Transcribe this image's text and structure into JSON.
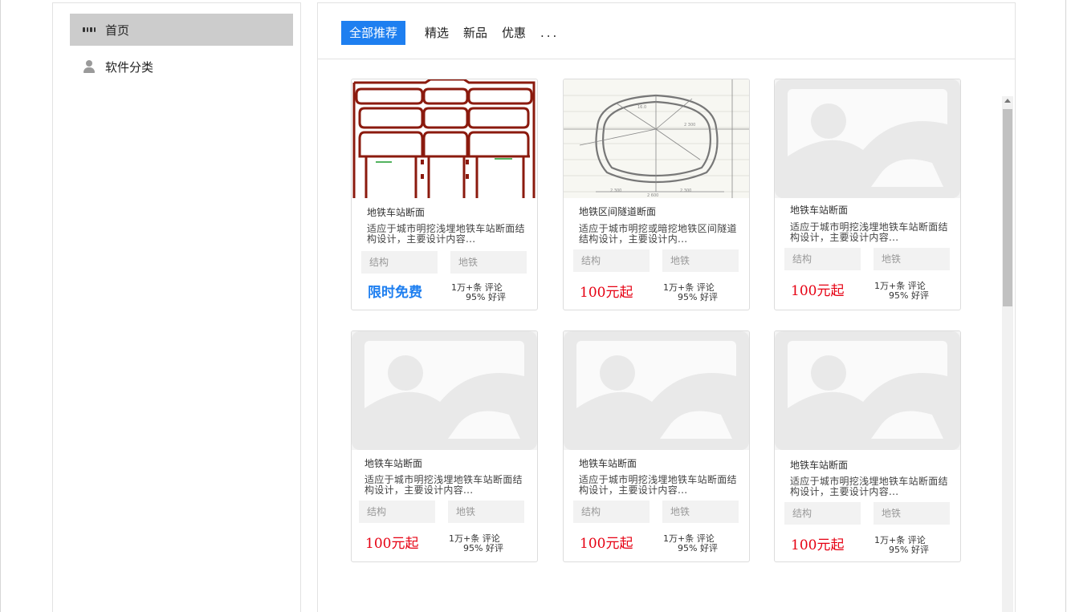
{
  "sidebar": {
    "items": [
      {
        "label": "首页",
        "icon": "grid-icon",
        "active": true
      },
      {
        "label": "软件分类",
        "icon": "user-icon",
        "active": false
      }
    ]
  },
  "tabs": [
    {
      "label": "全部推荐",
      "active": true
    },
    {
      "label": "精选"
    },
    {
      "label": "新品"
    },
    {
      "label": "优惠"
    },
    {
      "label": "..."
    }
  ],
  "cards": [
    {
      "title": "地铁车站断面",
      "desc": "适应于城市明挖浅埋地铁车站断面结构设计，主要设计内容...",
      "tags": [
        "结构",
        "地铁"
      ],
      "price": "限时免费",
      "stat_line1": "1万+条 评论",
      "stat_line2": "95% 好评",
      "image": "station-section-drawing"
    },
    {
      "title": "地铁区间隧道断面",
      "desc": "适应于城市明挖或暗挖地铁区间隧道结构设计，主要设计内...",
      "tags": [
        "结构",
        "地铁"
      ],
      "price": "100元起",
      "stat_line1": "1万+条 评论",
      "stat_line2": "95% 好评",
      "image": "tunnel-section-drawing"
    },
    {
      "title": "地铁车站断面",
      "desc": "适应于城市明挖浅埋地铁车站断面结构设计，主要设计内容...",
      "tags": [
        "结构",
        "地铁"
      ],
      "price": "100元起",
      "stat_line1": "1万+条 评论",
      "stat_line2": "95% 好评",
      "image": "image-placeholder"
    },
    {
      "title": "地铁车站断面",
      "desc": "适应于城市明挖浅埋地铁车站断面结构设计，主要设计内容...",
      "tags": [
        "结构",
        "地铁"
      ],
      "price": "100元起",
      "stat_line1": "1万+条 评论",
      "stat_line2": "95% 好评",
      "image": "image-placeholder"
    },
    {
      "title": "地铁车站断面",
      "desc": "适应于城市明挖浅埋地铁车站断面结构设计，主要设计内容...",
      "tags": [
        "结构",
        "地铁"
      ],
      "price": "100元起",
      "stat_line1": "1万+条 评论",
      "stat_line2": "95% 好评",
      "image": "image-placeholder"
    },
    {
      "title": "地铁车站断面",
      "desc": "适应于城市明挖浅埋地铁车站断面结构设计，主要设计内容...",
      "tags": [
        "结构",
        "地铁"
      ],
      "price": "100元起",
      "stat_line1": "1万+条 评论",
      "stat_line2": "95% 好评",
      "image": "image-placeholder"
    }
  ],
  "colors": {
    "accent": "#1e7ff0",
    "price": "#e60012",
    "active_sidebar": "#cccccc"
  }
}
